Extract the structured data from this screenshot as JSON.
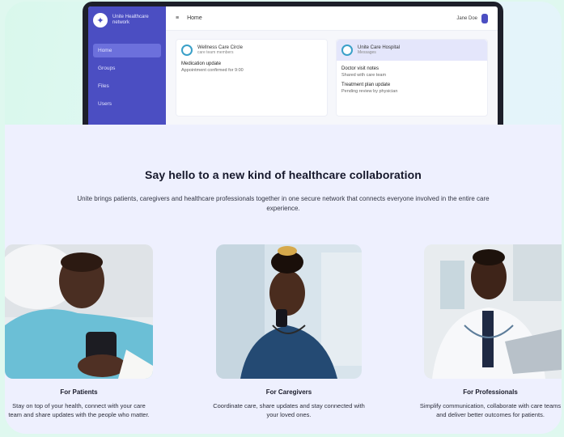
{
  "app": {
    "brand_name": "Unite Healthcare",
    "brand_tag": "network",
    "sidebar": [
      {
        "label": "Home"
      },
      {
        "label": "Groups"
      },
      {
        "label": "Files"
      },
      {
        "label": "Users"
      }
    ],
    "topbar_title": "Home",
    "user_name": "Jane Doe",
    "card_left": {
      "title": "Wellness Care Circle",
      "subtitle": "care team members",
      "line1": "Medication update",
      "line2": "Appointment confirmed for 9:00"
    },
    "card_right": {
      "title": "Unite Care Hospital",
      "subtitle": "Messages",
      "line1": "Doctor visit notes",
      "line1_sub": "Shared with care team",
      "line2": "Treatment plan update",
      "line2_sub": "Pending review by physician"
    }
  },
  "section": {
    "headline": "Say hello to a new kind of healthcare collaboration",
    "intro": "Unite brings patients, caregivers and healthcare professionals together in one secure network that connects everyone involved in the entire care experience."
  },
  "roles": [
    {
      "title": "For Patients",
      "desc": "Stay on top of your health, connect with your care team and share updates with the people who matter."
    },
    {
      "title": "For Caregivers",
      "desc": "Coordinate care, share updates and stay connected with your loved ones."
    },
    {
      "title": "For Professionals",
      "desc": "Simplify communication, collaborate with care teams and deliver better outcomes for patients."
    }
  ],
  "icons": {
    "brand": "heart-globe-icon",
    "menu": "hamburger-icon",
    "user": "user-avatar-icon"
  },
  "colors": {
    "sidebar": "#4b4ec2",
    "panel": "#eef0fe",
    "accent": "#6c70dc",
    "background": "#dff8ef"
  }
}
